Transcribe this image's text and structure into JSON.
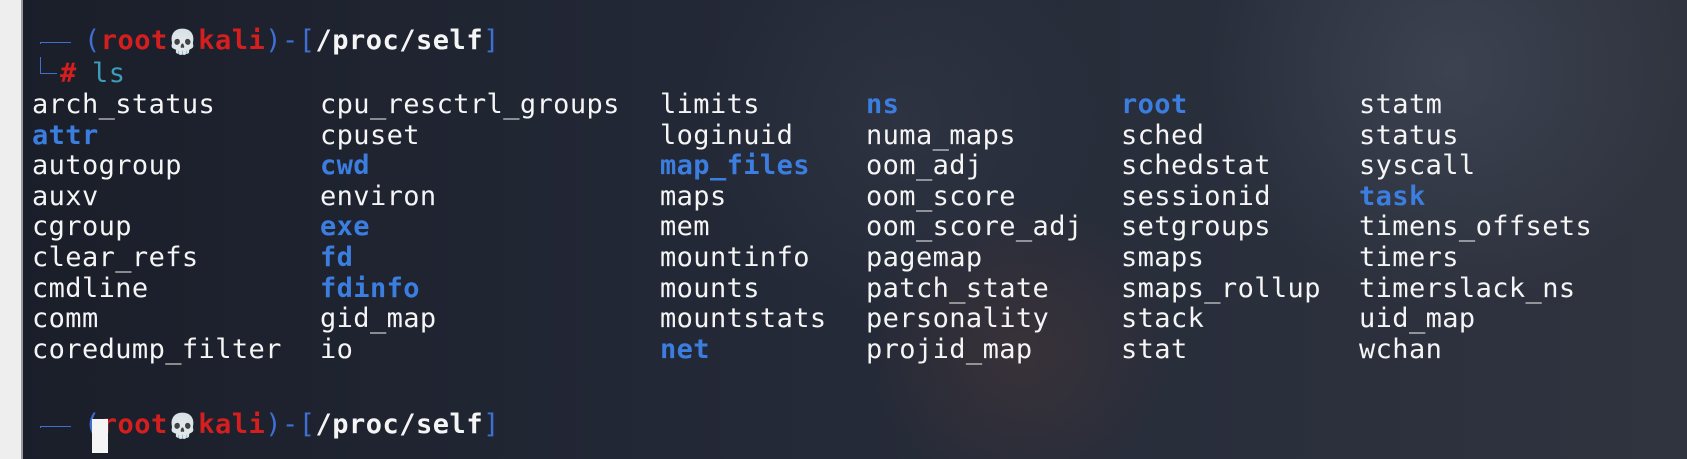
{
  "prompt": {
    "open_paren": "(",
    "user": "root",
    "skull": "💀",
    "host": "kali",
    "close_paren": ")",
    "dash": "-",
    "open_bracket": "[",
    "path": "/proc/self",
    "close_bracket": "]",
    "hash": "#",
    "command": "ls"
  },
  "ls_output": {
    "columns": [
      [
        {
          "name": "arch_status",
          "type": "file"
        },
        {
          "name": "attr",
          "type": "dir"
        },
        {
          "name": "autogroup",
          "type": "file"
        },
        {
          "name": "auxv",
          "type": "file"
        },
        {
          "name": "cgroup",
          "type": "file"
        },
        {
          "name": "clear_refs",
          "type": "file"
        },
        {
          "name": "cmdline",
          "type": "file"
        },
        {
          "name": "comm",
          "type": "file"
        },
        {
          "name": "coredump_filter",
          "type": "file"
        }
      ],
      [
        {
          "name": "cpu_resctrl_groups",
          "type": "file"
        },
        {
          "name": "cpuset",
          "type": "file"
        },
        {
          "name": "cwd",
          "type": "dir"
        },
        {
          "name": "environ",
          "type": "file"
        },
        {
          "name": "exe",
          "type": "dir"
        },
        {
          "name": "fd",
          "type": "dir"
        },
        {
          "name": "fdinfo",
          "type": "dir"
        },
        {
          "name": "gid_map",
          "type": "file"
        },
        {
          "name": "io",
          "type": "file"
        }
      ],
      [
        {
          "name": "limits",
          "type": "file"
        },
        {
          "name": "loginuid",
          "type": "file"
        },
        {
          "name": "map_files",
          "type": "dir"
        },
        {
          "name": "maps",
          "type": "file"
        },
        {
          "name": "mem",
          "type": "file"
        },
        {
          "name": "mountinfo",
          "type": "file"
        },
        {
          "name": "mounts",
          "type": "file"
        },
        {
          "name": "mountstats",
          "type": "file"
        },
        {
          "name": "net",
          "type": "dir"
        }
      ],
      [
        {
          "name": "ns",
          "type": "dir"
        },
        {
          "name": "numa_maps",
          "type": "file"
        },
        {
          "name": "oom_adj",
          "type": "file"
        },
        {
          "name": "oom_score",
          "type": "file"
        },
        {
          "name": "oom_score_adj",
          "type": "file"
        },
        {
          "name": "pagemap",
          "type": "file"
        },
        {
          "name": "patch_state",
          "type": "file"
        },
        {
          "name": "personality",
          "type": "file"
        },
        {
          "name": "projid_map",
          "type": "file"
        }
      ],
      [
        {
          "name": "root",
          "type": "dir"
        },
        {
          "name": "sched",
          "type": "file"
        },
        {
          "name": "schedstat",
          "type": "file"
        },
        {
          "name": "sessionid",
          "type": "file"
        },
        {
          "name": "setgroups",
          "type": "file"
        },
        {
          "name": "smaps",
          "type": "file"
        },
        {
          "name": "smaps_rollup",
          "type": "file"
        },
        {
          "name": "stack",
          "type": "file"
        },
        {
          "name": "stat",
          "type": "file"
        }
      ],
      [
        {
          "name": "statm",
          "type": "file"
        },
        {
          "name": "status",
          "type": "file"
        },
        {
          "name": "syscall",
          "type": "file"
        },
        {
          "name": "task",
          "type": "dir"
        },
        {
          "name": "timens_offsets",
          "type": "file"
        },
        {
          "name": "timers",
          "type": "file"
        },
        {
          "name": "timerslack_ns",
          "type": "file"
        },
        {
          "name": "uid_map",
          "type": "file"
        },
        {
          "name": "wchan",
          "type": "file"
        }
      ]
    ]
  },
  "colors": {
    "prompt_user": "#d51f1f",
    "prompt_decor": "#3f6fd3",
    "command": "#3c9cbc",
    "directory": "#3b7ee0",
    "file": "#f5f5f5",
    "background": "#1f2430"
  }
}
